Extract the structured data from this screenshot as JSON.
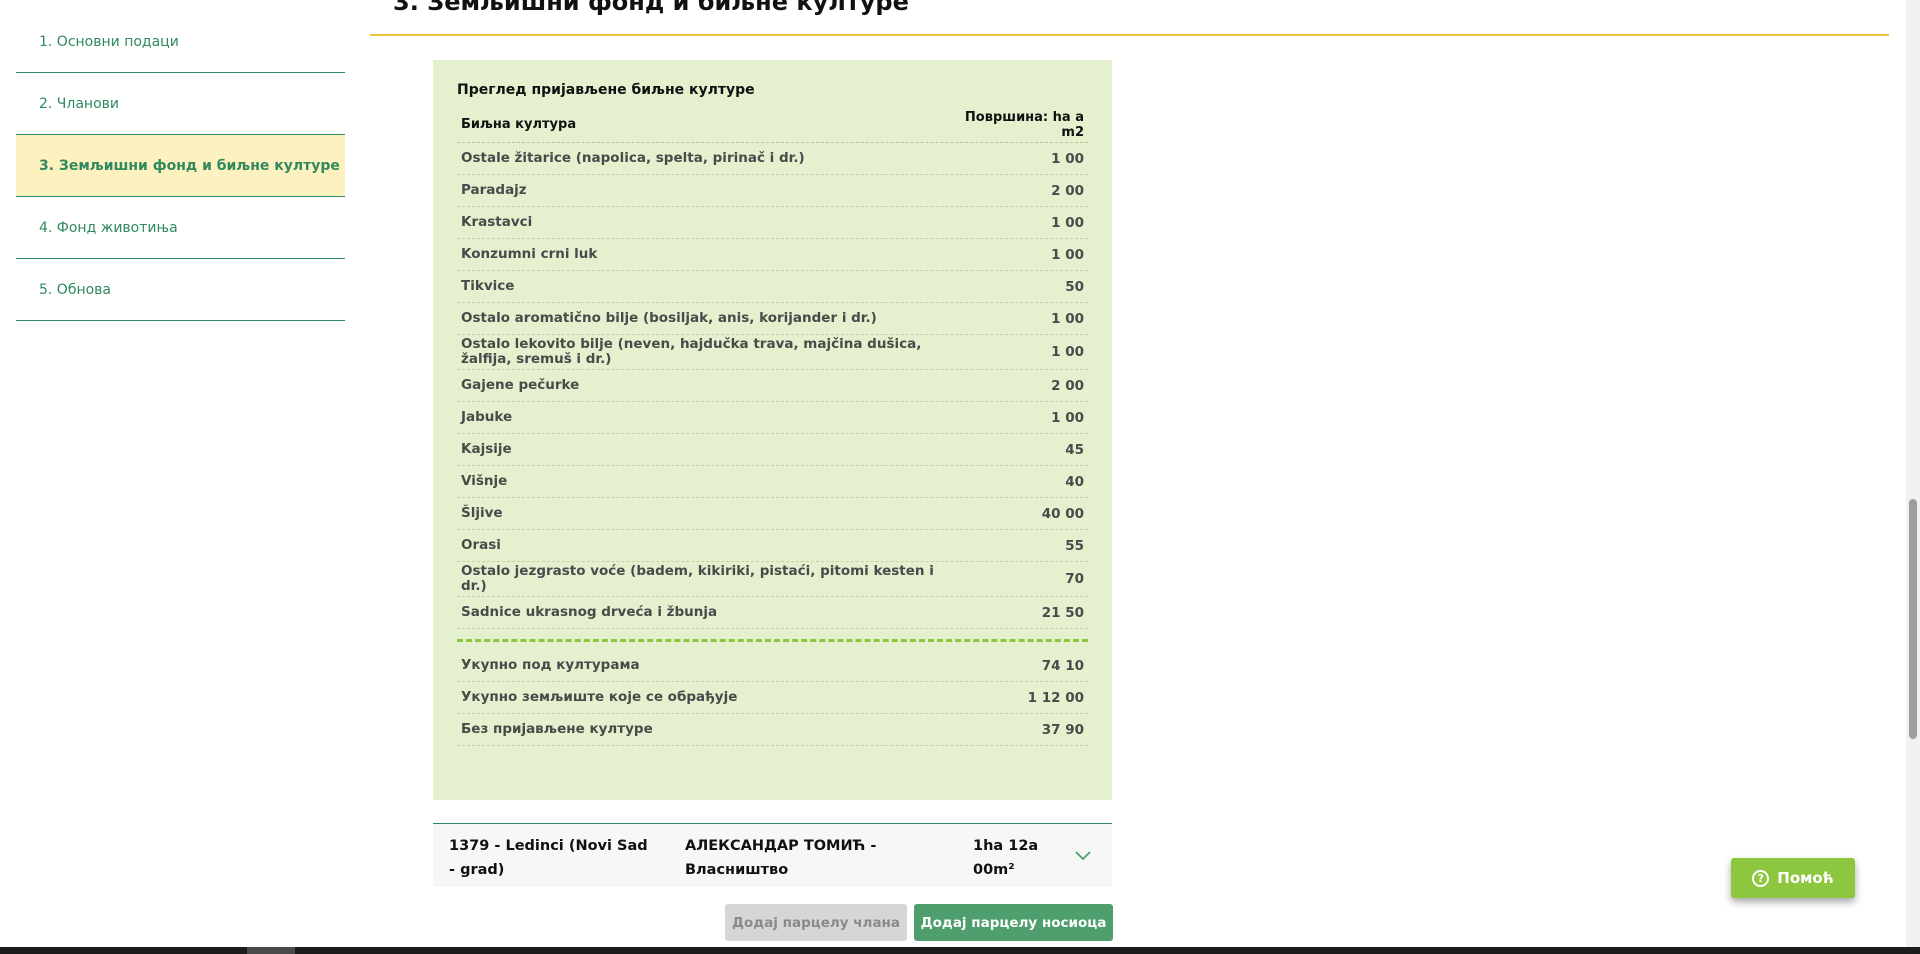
{
  "sidebar": {
    "items": [
      {
        "label": "1. Основни подаци"
      },
      {
        "label": "2. Чланови"
      },
      {
        "label": "3. Земљишни фонд и биљне културе"
      },
      {
        "label": "4. Фонд животиња"
      },
      {
        "label": "5. Обнова"
      }
    ],
    "active_index": 2
  },
  "section": {
    "title": "3. Земљишни фонд и биљне културе"
  },
  "panel": {
    "title": "Преглед пријављене биљне културе",
    "header_crop": "Биљна култура",
    "header_area": "Површина: ha a m2",
    "crops": [
      {
        "name": "Ostale žitarice (napolica, spelta, pirinač i dr.)",
        "area": "1 00"
      },
      {
        "name": "Paradajz",
        "area": "2 00"
      },
      {
        "name": "Krastavci",
        "area": "1 00"
      },
      {
        "name": "Konzumni crni luk",
        "area": "1 00"
      },
      {
        "name": "Tikvice",
        "area": "50"
      },
      {
        "name": "Ostalo aromatično bilje (bosiljak, anis, korijander i dr.)",
        "area": "1 00"
      },
      {
        "name": "Ostalo lekovito bilje (neven, hajdučka trava, majčina dušica, žalfija, sremuš i dr.)",
        "area": "1 00"
      },
      {
        "name": "Gajene pečurke",
        "area": "2 00"
      },
      {
        "name": "Jabuke",
        "area": "1 00"
      },
      {
        "name": "Kajsije",
        "area": "45"
      },
      {
        "name": "Višnje",
        "area": "40"
      },
      {
        "name": "Šljive",
        "area": "40 00"
      },
      {
        "name": "Orasi",
        "area": "55"
      },
      {
        "name": "Ostalo jezgrasto voće (badem, kikiriki, pistaći, pitomi kesten i dr.)",
        "area": "70"
      },
      {
        "name": "Sadnice ukrasnog drveća i žbunja",
        "area": "21 50"
      }
    ],
    "totals": [
      {
        "name": "Укупно под културама",
        "area": "74 10"
      },
      {
        "name": "Укупно земљиште које се обрађује",
        "area": "1 12 00"
      },
      {
        "name": "Без пријављене културе",
        "area": "37 90"
      }
    ]
  },
  "parcel": {
    "location": "1379 - Ledinci (Novi Sad - grad)",
    "owner": "АЛЕКСАНДАР ТОМИЋ - Власништво",
    "area": "1ha 12a 00m²"
  },
  "buttons": {
    "add_member_parcel": "Додај парцелу члана",
    "add_holder_parcel": "Додај парцелу носиоца"
  },
  "help": {
    "label": "Помоћ"
  },
  "colors": {
    "accent_green": "#2f8a5e",
    "panel_bg": "#e5f0cf",
    "active_bg": "#fdf1bf",
    "rule_yellow": "#f1c232",
    "help_bg": "#8dc63f"
  }
}
